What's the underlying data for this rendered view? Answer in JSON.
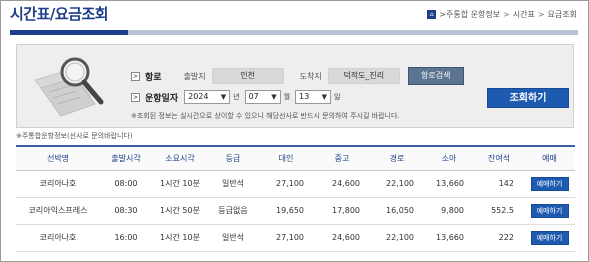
{
  "page": {
    "title": "시간표/요금조회",
    "breadcrumb": [
      ">주통합 운항정보",
      "시간표",
      "요금조회"
    ]
  },
  "search": {
    "route_label": "항로",
    "departure_label": "출발지",
    "departure_value": "인천",
    "arrival_label": "도착지",
    "arrival_value": "덕적도_진리",
    "route_search_button": "항로검색",
    "date_label": "운항일자",
    "year": "2024",
    "year_unit": "년",
    "month": "07",
    "month_unit": "월",
    "day": "13",
    "day_unit": "일",
    "search_button": "조회하기",
    "notice": "※조회된 정보는 실시간으로 상이할 수 있으니 해당선사로 반드시 문의하여 주시길 바랍니다."
  },
  "flag_note": "※주통합운항정보(선사로 문의바랍니다)",
  "table": {
    "headers": [
      "선박명",
      "출발시각",
      "소요시각",
      "등급",
      "대인",
      "중고",
      "경로",
      "소아",
      "잔여석",
      "예매"
    ],
    "reserve_label": "예매하기",
    "rows": [
      {
        "ship": "코리아나호",
        "depart": "08:00",
        "duration": "1시간 10분",
        "grade": "일반석",
        "adult": "27,100",
        "youth": "24,600",
        "senior": "22,100",
        "child": "13,660",
        "seats": "142"
      },
      {
        "ship": "코리아익스프레스",
        "depart": "08:30",
        "duration": "1시간 50분",
        "grade": "등급없음",
        "adult": "19,650",
        "youth": "17,800",
        "senior": "16,050",
        "child": "9,800",
        "seats": "552.5"
      },
      {
        "ship": "코리아나호",
        "depart": "16:00",
        "duration": "1시간 10분",
        "grade": "일반석",
        "adult": "27,100",
        "youth": "24,600",
        "senior": "22,100",
        "child": "13,660",
        "seats": "222"
      }
    ]
  },
  "colors": {
    "brand": "#1d3f8a",
    "button": "#1e5bb0",
    "route_button": "#5a7491"
  }
}
